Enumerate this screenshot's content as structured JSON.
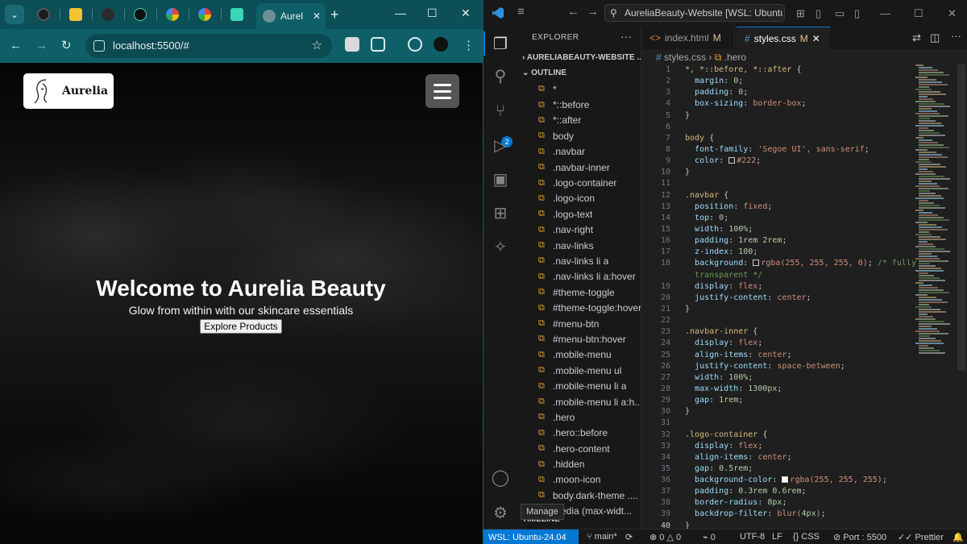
{
  "browser": {
    "tabs": [
      {
        "name": "tab-1",
        "color": "#1a1a1a"
      },
      {
        "name": "tab-2",
        "color": "#f1c232"
      },
      {
        "name": "tab-3",
        "color": "#2b2b2b"
      },
      {
        "name": "tab-4",
        "color": "#111111"
      },
      {
        "name": "tab-5",
        "color": "#4285f4"
      },
      {
        "name": "tab-6",
        "color": "#4285f4"
      },
      {
        "name": "tab-7",
        "color": "#3bd6b5"
      }
    ],
    "active_tab": {
      "label": "Aurel",
      "close": "✕"
    },
    "new_tab_icon": "+",
    "window_controls": {
      "minimize": "—",
      "maximize": "☐",
      "close": "✕"
    },
    "nav": {
      "back": "←",
      "forward": "→",
      "reload": "↻"
    },
    "url": "localhost:5500/#",
    "star_icon": "☆",
    "more_icon": "⋮"
  },
  "site": {
    "logo_text": "Aurelia",
    "hero_title": "Welcome to Aurelia Beauty",
    "hero_subtitle": "Glow from within with our skincare essentials",
    "hero_button": "Explore Products"
  },
  "vscode": {
    "title": "AureliaBeauty-Website [WSL: Ubuntu-24.04",
    "explorer_title": "EXPLORER",
    "more_icon": "···",
    "folder": "AURELIABEAUTY-WEBSITE ...",
    "outline_header": "OUTLINE",
    "outline_items": [
      "*",
      "*::before",
      "*::after",
      "body",
      ".navbar",
      ".navbar-inner",
      ".logo-container",
      ".logo-icon",
      ".logo-text",
      ".nav-right",
      ".nav-links",
      ".nav-links li a",
      ".nav-links li a:hover",
      "#theme-toggle",
      "#theme-toggle:hover",
      "#menu-btn",
      "#menu-btn:hover",
      ".mobile-menu",
      ".mobile-menu ul",
      ".mobile-menu li a",
      ".mobile-menu li a:h...",
      ".hero",
      ".hero::before",
      ".hero-content",
      ".hidden",
      ".moon-icon",
      "body.dark-theme ....",
      "media (max-widt..."
    ],
    "timeline_label": "TIMELINE",
    "tooltip": "Manage",
    "source_control_badge": "2",
    "tabs": [
      {
        "label": "index.html",
        "modified": "M"
      },
      {
        "label": "styles.css",
        "modified": "M",
        "close": "✕"
      }
    ],
    "breadcrumb": {
      "file": "styles.css",
      "symbol": ".hero",
      "separator": "›"
    },
    "line_numbers": [
      "1",
      "2",
      "3",
      "4",
      "5",
      "6",
      "7",
      "8",
      "9",
      "10",
      "11",
      "12",
      "13",
      "14",
      "15",
      "16",
      "17",
      "18",
      "",
      "19",
      "20",
      "21",
      "22",
      "23",
      "24",
      "25",
      "26",
      "27",
      "28",
      "29",
      "30",
      "31",
      "32",
      "33",
      "34",
      "35",
      "36",
      "37",
      "38",
      "39",
      "40"
    ],
    "status": {
      "remote": "WSL: Ubuntu-24.04",
      "branch": "main*",
      "sync_icon": "⟳",
      "errors": "0",
      "warnings": "0",
      "ports_count": "0",
      "encoding": "UTF-8",
      "eol": "LF",
      "language": "CSS",
      "port": "Port : 5500",
      "prettier": "Prettier",
      "bell_icon": "🔔"
    }
  }
}
